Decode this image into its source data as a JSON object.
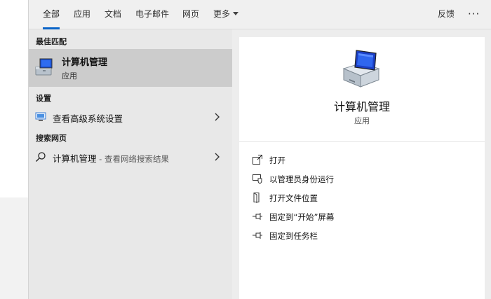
{
  "tabs": [
    {
      "label": "全部",
      "active": true
    },
    {
      "label": "应用",
      "active": false
    },
    {
      "label": "文档",
      "active": false
    },
    {
      "label": "电子邮件",
      "active": false
    },
    {
      "label": "网页",
      "active": false
    },
    {
      "label": "更多",
      "active": false
    }
  ],
  "header_right": {
    "feedback": "反馈",
    "more": "···"
  },
  "results": {
    "best_match_heading": "最佳匹配",
    "best_match": {
      "title": "计算机管理",
      "subtitle": "应用",
      "icon": "computer-management-icon"
    },
    "settings_heading": "设置",
    "settings_item": {
      "label": "查看高级系统设置",
      "icon": "monitor-settings-icon"
    },
    "web_heading": "搜索网页",
    "web_item": {
      "label": "计算机管理",
      "suffix": " - 查看网络搜索结果",
      "icon": "search-icon"
    }
  },
  "detail": {
    "title": "计算机管理",
    "type": "应用",
    "actions": [
      {
        "label": "打开",
        "icon": "open-icon"
      },
      {
        "label": "以管理员身份运行",
        "icon": "run-as-admin-icon"
      },
      {
        "label": "打开文件位置",
        "icon": "file-location-icon"
      },
      {
        "label": "固定到“开始”屏幕",
        "icon": "pin-start-icon"
      },
      {
        "label": "固定到任务栏",
        "icon": "pin-taskbar-icon"
      }
    ]
  },
  "colors": {
    "accent": "#0a64c8",
    "selected_bg": "#cccccc"
  }
}
